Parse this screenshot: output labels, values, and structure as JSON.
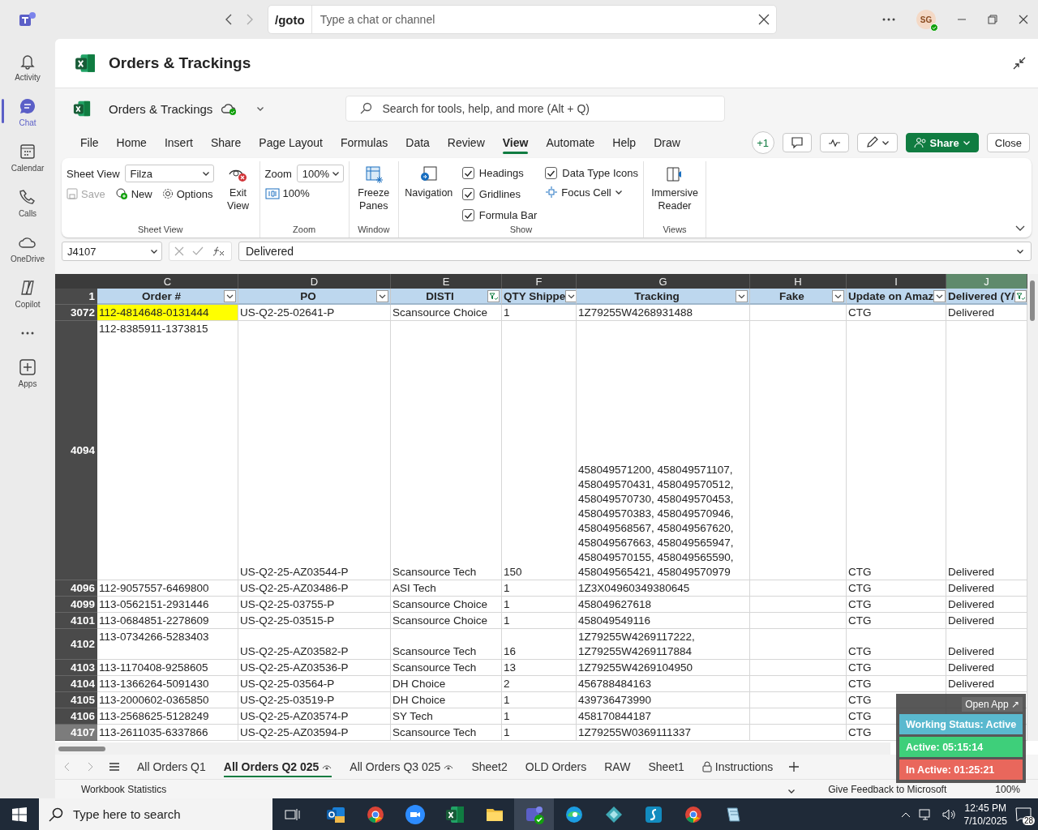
{
  "titlebar": {
    "command": "/goto",
    "placeholder": "Type a chat or channel",
    "avatar": "SG"
  },
  "rail": [
    {
      "label": "Activity",
      "selected": false
    },
    {
      "label": "Chat",
      "selected": true
    },
    {
      "label": "Calendar",
      "selected": false
    },
    {
      "label": "Calls",
      "selected": false
    },
    {
      "label": "OneDrive",
      "selected": false
    },
    {
      "label": "Copilot",
      "selected": false
    },
    {
      "selected": false
    },
    {
      "label": "Apps",
      "selected": false
    }
  ],
  "app_title": "Orders & Trackings",
  "workbook": {
    "name": "Orders & Trackings",
    "search_placeholder": "Search for tools, help, and more (Alt + Q)"
  },
  "menu": [
    {
      "label": "File",
      "selected": false
    },
    {
      "label": "Home",
      "selected": false
    },
    {
      "label": "Insert",
      "selected": false
    },
    {
      "label": "Share",
      "selected": false
    },
    {
      "label": "Page Layout",
      "selected": false
    },
    {
      "label": "Formulas",
      "selected": false
    },
    {
      "label": "Data",
      "selected": false
    },
    {
      "label": "Review",
      "selected": false
    },
    {
      "label": "View",
      "selected": true
    },
    {
      "label": "Automate",
      "selected": false
    },
    {
      "label": "Help",
      "selected": false
    },
    {
      "label": "Draw",
      "selected": false
    }
  ],
  "menu_actions": {
    "presence_count": "+1",
    "share": "Share",
    "close": "Close"
  },
  "ribbon": {
    "sheet_view": {
      "title": "Sheet View",
      "view_label": "Sheet View",
      "view_value": "Filza",
      "save": {
        "label": "Save",
        "disabled": true
      },
      "new": "New",
      "options": "Options",
      "exit": "Exit View"
    },
    "zoom": {
      "title": "Zoom",
      "label": "Zoom",
      "value": "100%",
      "reset": "100%"
    },
    "window": {
      "title": "Window",
      "freeze": "Freeze Panes"
    },
    "show": {
      "title": "Show",
      "navigation": "Navigation",
      "checkboxes": [
        {
          "label": "Headings",
          "checked": true
        },
        {
          "label": "Gridlines",
          "checked": true
        },
        {
          "label": "Formula Bar",
          "checked": true
        },
        {
          "label": "Data Type Icons",
          "checked": true
        }
      ],
      "focus_cell": "Focus Cell"
    },
    "views": {
      "title": "Views",
      "reader": "Immersive Reader"
    }
  },
  "formula_bar": {
    "name_box": "J4107",
    "formula": "Delivered"
  },
  "columns": [
    {
      "letter": "C",
      "header": "Order #",
      "filtered": false,
      "selected": false
    },
    {
      "letter": "D",
      "header": "PO",
      "filtered": false,
      "selected": false
    },
    {
      "letter": "E",
      "header": "DISTI",
      "filtered": true,
      "selected": false
    },
    {
      "letter": "F",
      "header": "QTY Shippe",
      "filtered": false,
      "selected": false
    },
    {
      "letter": "G",
      "header": "Tracking",
      "filtered": false,
      "selected": false
    },
    {
      "letter": "H",
      "header": "Fake",
      "filtered": false,
      "selected": false
    },
    {
      "letter": "I",
      "header": "Update on Amaz",
      "filtered": false,
      "selected": false
    },
    {
      "letter": "J",
      "header": "Delivered (Y/",
      "filtered": true,
      "selected": true
    }
  ],
  "header_row": "1",
  "rows": [
    {
      "number": "3072",
      "kind": "standard",
      "selected": false,
      "highlighted": true,
      "c": "112-4814648-0131444",
      "d": "US-Q2-25-02641-P",
      "e": "Scansource Choice",
      "f": "1",
      "g": "1Z79255W4268931488",
      "i": "CTG",
      "j": "Delivered"
    },
    {
      "number": "4094",
      "kind": "tall",
      "selected": false,
      "highlighted": false,
      "c": "112-8385911-1373815",
      "d": "US-Q2-25-AZ03544-P",
      "e": "Scansource Tech",
      "f": "150",
      "g": "458049571200, 458049571107, 458049570431, 458049570512, 458049570730, 458049570453, 458049570383, 458049570946, 458049568567, 458049567620, 458049567663, 458049565947, 458049570155, 458049565590, 458049565421, 458049570979",
      "i": "CTG",
      "j": "Delivered"
    },
    {
      "number": "4096",
      "kind": "standard",
      "selected": false,
      "highlighted": false,
      "c": "112-9057557-6469800",
      "d": "US-Q2-25-AZ03486-P",
      "e": "ASI Tech",
      "f": "1",
      "g": "1Z3X04960349380645",
      "i": "CTG",
      "j": "Delivered"
    },
    {
      "number": "4099",
      "kind": "standard",
      "selected": false,
      "highlighted": false,
      "c": "113-0562151-2931446",
      "d": "US-Q2-25-03755-P",
      "e": "Scansource Choice",
      "f": "1",
      "g": "458049627618",
      "i": "CTG",
      "j": "Delivered"
    },
    {
      "number": "4101",
      "kind": "standard",
      "selected": false,
      "highlighted": false,
      "c": "113-0684851-2278609",
      "d": "US-Q2-25-03515-P",
      "e": "Scansource Choice",
      "f": "1",
      "g": "458049549116",
      "i": "CTG",
      "j": "Delivered"
    },
    {
      "number": "4102",
      "kind": "standard",
      "selected": false,
      "highlighted": false,
      "c": "113-0734266-5283403",
      "d": "US-Q2-25-AZ03582-P",
      "e": "Scansource Tech",
      "f": "16",
      "g": "1Z79255W4269117222, 1Z79255W4269117884",
      "i": "CTG",
      "j": "Delivered"
    },
    {
      "number": "4103",
      "kind": "standard",
      "selected": false,
      "highlighted": false,
      "c": "113-1170408-9258605",
      "d": "US-Q2-25-AZ03536-P",
      "e": "Scansource Tech",
      "f": "13",
      "g": "1Z79255W4269104950",
      "i": "CTG",
      "j": "Delivered"
    },
    {
      "number": "4104",
      "kind": "standard",
      "selected": false,
      "highlighted": false,
      "c": "113-1366264-5091430",
      "d": "US-Q2-25-03564-P",
      "e": "DH Choice",
      "f": "2",
      "g": "456788484163",
      "i": "CTG",
      "j": "Delivered"
    },
    {
      "number": "4105",
      "kind": "standard",
      "selected": false,
      "highlighted": false,
      "c": "113-2000602-0365850",
      "d": "US-Q2-25-03519-P",
      "e": "DH Choice",
      "f": "1",
      "g": "439736473990",
      "i": "CTG"
    },
    {
      "number": "4106",
      "kind": "standard",
      "selected": false,
      "highlighted": false,
      "c": "113-2568625-5128249",
      "d": "US-Q2-25-AZ03574-P",
      "e": "SY Tech",
      "f": "1",
      "g": "458170844187",
      "i": "CTG"
    },
    {
      "number": "4107",
      "kind": "standard",
      "selected": true,
      "highlighted": false,
      "c": "113-2611035-6337866",
      "d": "US-Q2-25-AZ03594-P",
      "e": "Scansource Tech",
      "f": "1",
      "g": "1Z79255W0369111337",
      "i": "CTG"
    }
  ],
  "sheet_tabs": [
    {
      "label": "All Orders Q1",
      "selected": false
    },
    {
      "label": "All Orders Q2 025",
      "selected": true,
      "kind": "watched"
    },
    {
      "label": "All Orders Q3 025",
      "selected": false,
      "kind": "watched"
    },
    {
      "label": "Sheet2",
      "selected": false
    },
    {
      "label": "OLD Orders",
      "selected": false
    },
    {
      "label": "RAW",
      "selected": false
    },
    {
      "label": "Sheet1",
      "selected": false
    },
    {
      "label": "Instructions",
      "selected": false,
      "kind": "protected"
    }
  ],
  "status_bar": {
    "left": "Workbook Statistics",
    "feedback": "Give Feedback to Microsoft",
    "zoom": "100%"
  },
  "status_widget": {
    "open": "Open App ↗",
    "working": "Working Status: Active",
    "active": "Active: 05:15:14",
    "inactive": "In Active: 01:25:21"
  },
  "taskbar": {
    "search_placeholder": "Type here to search",
    "apps": [
      {
        "kind": "mail",
        "selected": false
      },
      {
        "kind": "browser",
        "selected": false
      },
      {
        "kind": "video",
        "selected": false
      },
      {
        "kind": "sheet",
        "selected": false
      },
      {
        "kind": "folder",
        "selected": false
      },
      {
        "kind": "chat",
        "selected": true
      },
      {
        "kind": "wave",
        "selected": false
      },
      {
        "kind": "diamond",
        "selected": false
      },
      {
        "kind": "script",
        "selected": false
      },
      {
        "kind": "browser",
        "selected": false
      },
      {
        "kind": "notes",
        "selected": false
      }
    ],
    "time": "12:45 PM",
    "date": "7/10/2025",
    "notifications": "28"
  }
}
